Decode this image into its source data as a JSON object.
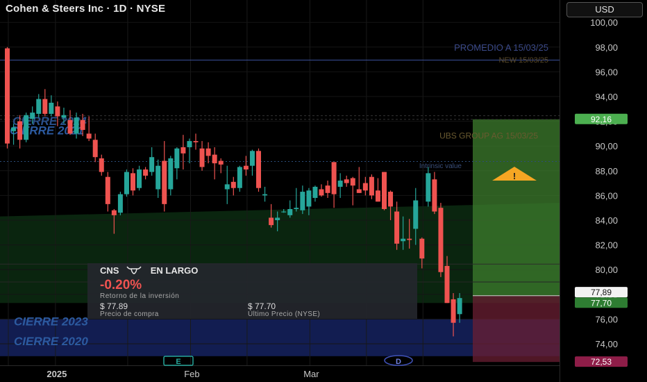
{
  "header": {
    "title": "Cohen & Steers Inc · 1D · NYSE",
    "currency": "USD"
  },
  "position_card": {
    "ticker": "CNS",
    "direction": "EN LARGO",
    "return_pct": "-0.20%",
    "return_label": "Retorno de la inversión",
    "buy_price": "$ 77.89",
    "buy_label": "Precio de compra",
    "last_price": "$ 77.70",
    "last_label": "Último Precio (NYSE)"
  },
  "colors": {
    "up": "#26a69a",
    "down": "#ef5350",
    "background": "#000000",
    "profit_zone": "#3e7d2e",
    "loss_zone": "#6b1f33",
    "warning": "#f5a623"
  },
  "chart_data": {
    "type": "candlestick",
    "ylim": [
      72.0,
      101.0
    ],
    "y_ticks": [
      "74,00",
      "76,00",
      "78,00",
      "80,00",
      "82,00",
      "84,00",
      "86,00",
      "88,00",
      "90,00",
      "92,00",
      "94,00",
      "96,00",
      "98,00",
      "100,00"
    ],
    "x_tick_labels": [
      {
        "label": "2025",
        "bar": 7.5
      },
      {
        "label": "Feb",
        "bar": 29
      },
      {
        "label": "Mar",
        "bar": 48
      }
    ],
    "candles": [
      [
        97.9,
        98.0,
        89.8,
        90.2
      ],
      [
        91.2,
        91.8,
        90.1,
        91.5
      ],
      [
        92.0,
        92.5,
        89.8,
        90.5
      ],
      [
        90.5,
        92.7,
        90.3,
        92.5
      ],
      [
        92.2,
        93.2,
        91.8,
        92.7
      ],
      [
        92.6,
        94.2,
        92.3,
        93.8
      ],
      [
        93.8,
        94.6,
        92.4,
        92.6
      ],
      [
        92.6,
        94.1,
        92.4,
        93.5
      ],
      [
        93.2,
        93.6,
        91.6,
        92.4
      ],
      [
        92.3,
        93.1,
        91.8,
        92.5
      ],
      [
        92.1,
        92.9,
        90.9,
        91.0
      ],
      [
        91.0,
        92.7,
        90.6,
        92.3
      ],
      [
        92.1,
        92.6,
        90.8,
        91.3
      ],
      [
        91.0,
        92.4,
        90.4,
        90.6
      ],
      [
        90.5,
        91.0,
        88.7,
        89.1
      ],
      [
        89.0,
        89.3,
        87.6,
        87.9
      ],
      [
        87.5,
        87.9,
        84.7,
        85.3
      ],
      [
        84.8,
        84.9,
        82.9,
        84.4
      ],
      [
        84.6,
        86.3,
        84.4,
        86.1
      ],
      [
        86.1,
        88.1,
        85.9,
        87.9
      ],
      [
        87.8,
        88.2,
        86.0,
        86.4
      ],
      [
        86.6,
        88.4,
        86.4,
        88.1
      ],
      [
        88.1,
        88.3,
        87.3,
        87.6
      ],
      [
        87.9,
        89.9,
        87.6,
        89.1
      ],
      [
        86.5,
        88.9,
        85.8,
        88.4
      ],
      [
        88.8,
        90.4,
        84.7,
        85.3
      ],
      [
        86.5,
        89.2,
        86.0,
        89.0
      ],
      [
        88.2,
        89.9,
        87.3,
        89.8
      ],
      [
        89.9,
        90.9,
        88.1,
        89.4
      ],
      [
        89.9,
        90.6,
        88.6,
        90.4
      ],
      [
        90.4,
        91.0,
        89.7,
        90.3
      ],
      [
        89.8,
        90.4,
        88.0,
        88.3
      ],
      [
        89.8,
        90.3,
        88.6,
        89.2
      ],
      [
        89.3,
        89.9,
        87.3,
        88.6
      ],
      [
        88.8,
        89.0,
        87.8,
        88.5
      ],
      [
        86.5,
        88.4,
        85.3,
        86.9
      ],
      [
        87.1,
        87.5,
        86.0,
        86.6
      ],
      [
        86.6,
        88.4,
        86.3,
        88.3
      ],
      [
        88.4,
        89.2,
        87.6,
        88.1
      ],
      [
        88.4,
        89.7,
        87.6,
        89.6
      ],
      [
        89.6,
        89.8,
        86.3,
        86.6
      ],
      [
        86.0,
        86.7,
        85.5,
        86.1
      ],
      [
        84.2,
        85.3,
        83.4,
        83.6
      ],
      [
        84.0,
        84.7,
        83.1,
        84.2
      ],
      [
        84.7,
        84.9,
        84.6,
        84.7
      ],
      [
        84.4,
        85.6,
        84.2,
        84.9
      ],
      [
        84.9,
        86.6,
        84.7,
        85.0
      ],
      [
        84.8,
        86.8,
        84.5,
        86.3
      ],
      [
        85.1,
        86.6,
        84.4,
        86.4
      ],
      [
        85.8,
        86.8,
        85.5,
        86.7
      ],
      [
        86.5,
        86.9,
        85.9,
        86.0
      ],
      [
        86.8,
        87.2,
        85.8,
        86.2
      ],
      [
        88.7,
        88.7,
        85.0,
        86.1
      ],
      [
        86.7,
        87.8,
        85.8,
        87.2
      ],
      [
        87.3,
        87.6,
        86.7,
        87.0
      ],
      [
        87.4,
        87.5,
        85.2,
        86.8
      ],
      [
        86.5,
        88.3,
        86.2,
        86.2
      ],
      [
        87.0,
        87.5,
        86.0,
        86.4
      ],
      [
        87.5,
        87.7,
        85.7,
        86.0
      ],
      [
        86.4,
        87.4,
        85.5,
        85.5
      ],
      [
        87.9,
        87.9,
        84.8,
        84.9
      ],
      [
        86.3,
        86.4,
        84.0,
        85.1
      ],
      [
        84.7,
        85.5,
        81.6,
        82.1
      ],
      [
        82.3,
        84.3,
        81.6,
        82.5
      ],
      [
        82.5,
        84.1,
        81.7,
        82.4
      ],
      [
        83.3,
        86.6,
        82.0,
        85.6
      ],
      [
        82.5,
        82.6,
        80.1,
        80.9
      ],
      [
        85.5,
        88.3,
        85.1,
        87.8
      ],
      [
        87.3,
        87.9,
        84.5,
        84.7
      ],
      [
        85.0,
        85.4,
        79.4,
        79.8
      ],
      [
        80.3,
        81.1,
        77.3,
        77.3
      ],
      [
        77.6,
        78.1,
        74.6,
        75.7
      ],
      [
        76.4,
        78.1,
        75.7,
        77.7
      ]
    ],
    "annotations": [
      "PROMEDIO A 15/03/25",
      "NEW 15/03/25",
      "CIERRE 2024",
      "CIERRE 2021",
      "UBS GROUP AG 15/03/25",
      "Intrinsic value",
      "CIERRE 2023",
      "CIERRE 2020"
    ],
    "price_labels": {
      "target": "92,16",
      "entry": "77,89",
      "last": "77,70",
      "stop": "72,53"
    },
    "event_markers": [
      "E",
      "D"
    ]
  }
}
